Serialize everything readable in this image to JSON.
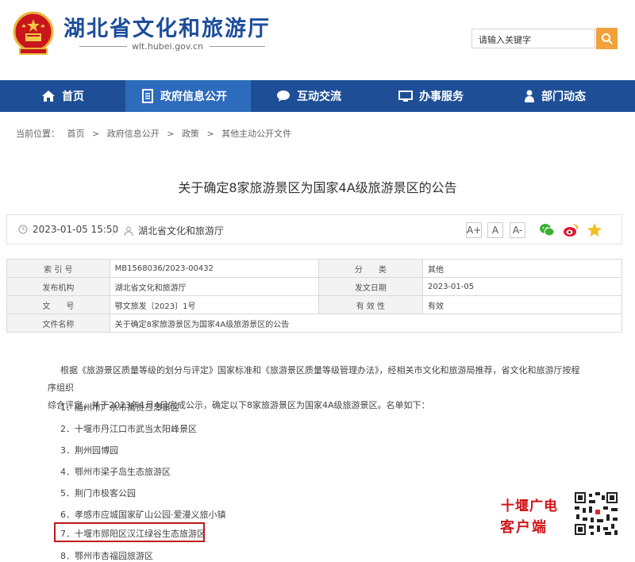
{
  "header": {
    "site_title": "湖北省文化和旅游厅",
    "site_url": "wlt.hubei.gov.cn",
    "search_placeholder": "请输入关键字"
  },
  "nav": {
    "items": [
      {
        "label": "首页",
        "icon": "home-icon"
      },
      {
        "label": "政府信息公开",
        "icon": "document-icon",
        "active": true
      },
      {
        "label": "互动交流",
        "icon": "chat-icon"
      },
      {
        "label": "办事服务",
        "icon": "monitor-icon"
      },
      {
        "label": "部门动态",
        "icon": "person-icon"
      }
    ],
    "bg_color": "#1e4f96",
    "active_color": "#2d6bbd"
  },
  "breadcrumb": {
    "prefix": "当前位置：",
    "items": [
      "首页",
      "政府信息公开",
      "政策",
      "其他主动公开文件"
    ],
    "separator": ">"
  },
  "article": {
    "title": "关于确定8家旅游景区为国家4A级旅游景区的公告",
    "date": "2023-01-05 15:50",
    "source": "湖北省文化和旅游厅",
    "font_sizes": [
      "A+",
      "A",
      "A-"
    ]
  },
  "info_table": {
    "rows": [
      {
        "l1": "索 引 号",
        "v1": "MB1568036/2023-00432",
        "l2": "分　　类",
        "v2": "其他"
      },
      {
        "l1": "发布机构",
        "v1": "湖北省文化和旅游厅",
        "l2": "发文日期",
        "v2": "2023-01-05"
      },
      {
        "l1": "文　　号",
        "v1": "鄂文旅发〔2023〕1号",
        "l2": "有 效 性",
        "v2": "有效"
      },
      {
        "l1": "文件名称",
        "v1": "关于确定8家旅游景区为国家4A级旅游景区的公告",
        "l2": "",
        "v2": ""
      }
    ]
  },
  "body": {
    "paragraph_line1": "根据《旅游景区质量等级的划分与评定》国家标准和《旅游景区质量等级管理办法》，经相关市文化和旅游局推荐，省文化和旅游厅按程序组织",
    "paragraph_line2": "综合评定，并于2023年1月4日完成公示，确定以下8家旅游景区为国家4A级旅游景区。名单如下：",
    "list": [
      "1．随州市广水市寓贵三潭景区",
      "2．十堰市丹江口市武当太阳峰景区",
      "3．荆州园博园",
      "4．鄂州市梁子岛生态旅游区",
      "5．荆门市极客公园",
      "6．孝感市应城国家矿山公园·爱漫义旅小镇",
      "7．十堰市郧阳区汉江绿谷生态旅游区",
      "8．鄂州市杏福园旅游区"
    ],
    "highlighted_index": 6
  },
  "watermark": {
    "line1": "十堰广电",
    "line2": "客户端",
    "color": "#d0141a"
  }
}
